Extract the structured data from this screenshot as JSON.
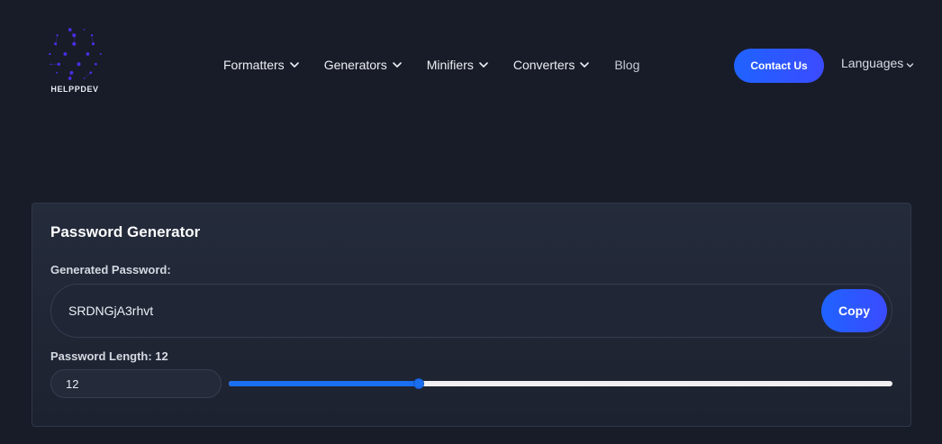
{
  "brand": {
    "name": "HELPPDEV",
    "logo_icon": "network-globe-icon",
    "logo_color": "#4b2ee8"
  },
  "nav": {
    "items": [
      {
        "label": "Formatters",
        "has_dropdown": true
      },
      {
        "label": "Generators",
        "has_dropdown": true
      },
      {
        "label": "Minifiers",
        "has_dropdown": true
      },
      {
        "label": "Converters",
        "has_dropdown": true
      },
      {
        "label": "Blog",
        "has_dropdown": false
      }
    ],
    "contact_label": "Contact Us",
    "languages_label": "Languages"
  },
  "generator": {
    "title": "Password Generator",
    "generated_label": "Generated Password:",
    "password": "SRDNGjA3rhvt",
    "copy_label": "Copy",
    "length_label": "Password Length: 12",
    "length_value": "12",
    "slider": {
      "value": 12,
      "min": 4,
      "max": 32
    }
  },
  "colors": {
    "background": "#181c28",
    "accent": "#1f63ff",
    "slider_fill": "#1a6ff0"
  }
}
